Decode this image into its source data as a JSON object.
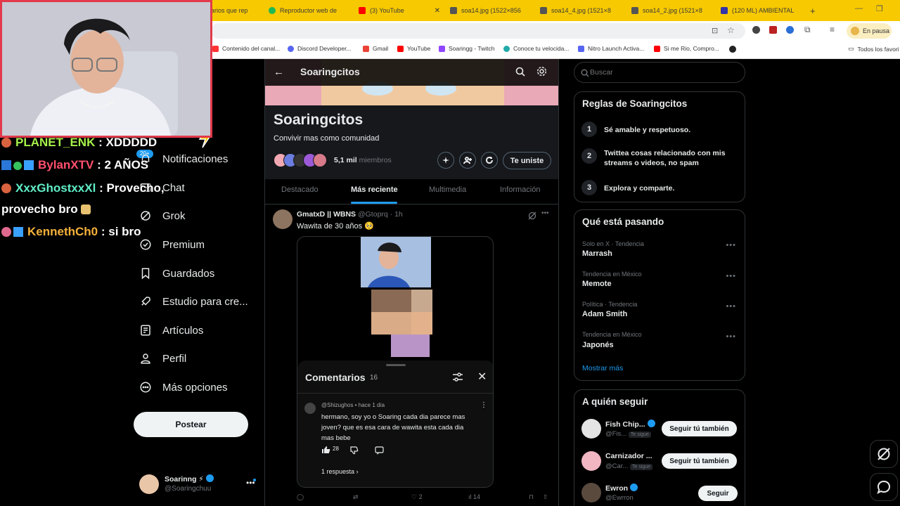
{
  "browser": {
    "tabs": [
      {
        "label": "arios que rep",
        "color": "#e66"
      },
      {
        "label": "Reproductor web de",
        "color": "#1db954"
      },
      {
        "label": "(3) YouTube",
        "color": "#f00"
      },
      {
        "label": "soa14.jpg (1522×856",
        "color": "#888"
      },
      {
        "label": "soa14_4.jpg (1521×8",
        "color": "#888"
      },
      {
        "label": "soa14_2.jpg (1521×8",
        "color": "#888"
      },
      {
        "label": "(120 ML) AMBIENTAL",
        "color": "#33a"
      }
    ],
    "new_tab": "+",
    "profile_label": "En pausa",
    "bookmarks": [
      {
        "label": "Contenido del canal...",
        "color": "#f33"
      },
      {
        "label": "Discord Developer...",
        "color": "#5865f2"
      },
      {
        "label": "Gmail",
        "color": "#ea4335"
      },
      {
        "label": "YouTube",
        "color": "#f00"
      },
      {
        "label": "Soaringg - Twitch",
        "color": "#9146ff"
      },
      {
        "label": "Conoce tu velocida...",
        "color": "#2aa"
      },
      {
        "label": "Nitro Launch Activa...",
        "color": "#5865f2"
      },
      {
        "label": "Si me Rio, Compro...",
        "color": "#f00"
      }
    ],
    "all_bookmarks": "Todos los favori"
  },
  "chat": [
    {
      "user": "PLANET_ENK",
      "msg": ": XDDDDD",
      "color": "#a6f04a"
    },
    {
      "user": "BylanXTV",
      "msg": ": 2 AÑOS",
      "color": "#ff4f6d"
    },
    {
      "user": "XxxGhostxxXl",
      "msg": ": Provecho,",
      "color": "#5ff0c8"
    },
    {
      "cont": "provecho bro"
    },
    {
      "user": "KennethCh0",
      "msg": ": si bro",
      "color": "#f7b23b"
    }
  ],
  "sidebar": {
    "badge": "20+",
    "items": [
      "Notificaciones",
      "Chat",
      "Grok",
      "Premium",
      "Guardados",
      "Estudio para cre...",
      "Artículos",
      "Perfil",
      "Más opciones"
    ],
    "post_button": "Postear",
    "account": {
      "name": "Soarinng ⚡",
      "handle": "@Soaringchuu"
    }
  },
  "community": {
    "header_title": "Soaringcitos",
    "name": "Soaringcitos",
    "description": "Convivir mas como comunidad",
    "members_count": "5,1 mil",
    "members_label": "miembros",
    "join_button": "Te uniste",
    "tabs": [
      "Destacado",
      "Más reciente",
      "Multimedia",
      "Información"
    ],
    "active_tab": 1
  },
  "post": {
    "author": "GmatxD || WBNS",
    "handle": "@Gtoprq",
    "time": "· 1h",
    "text": "Wawita de 30 años 🥺",
    "actions": {
      "likes": "2",
      "views": "14"
    }
  },
  "comments": {
    "title": "Comentarios",
    "count": "16",
    "item": {
      "author": "@Shizughos",
      "time": "• hace 1 día",
      "text": "hermano, soy yo o Soaring cada dia parece mas joven? que es esa cara de wawita esta cada dia mas bebe",
      "likes": "28",
      "replies": "1 respuesta"
    }
  },
  "search": {
    "placeholder": "Buscar"
  },
  "rules": {
    "title": "Reglas de Soaringcitos",
    "items": [
      {
        "n": "1",
        "text": "Sé amable y respetuoso."
      },
      {
        "n": "2",
        "text": "Twittea cosas relacionado con mis streams o videos, no spam"
      },
      {
        "n": "3",
        "text": "Explora y comparte."
      }
    ]
  },
  "trends": {
    "title": "Qué está pasando",
    "items": [
      {
        "meta": "Solo en X · Tendencia",
        "name": "Marrash"
      },
      {
        "meta": "Tendencia en México",
        "name": "Memote"
      },
      {
        "meta": "Política · Tendencia",
        "name": "Adam Smith"
      },
      {
        "meta": "Tendencia en México",
        "name": "Japonés"
      }
    ],
    "show_more": "Mostrar más"
  },
  "who_to_follow": {
    "title": "A quién seguir",
    "items": [
      {
        "name": "Fish Chip...",
        "handle": "@Fis...",
        "follows": "Te sigue",
        "button": "Seguir tú también"
      },
      {
        "name": "Carnizador ...",
        "handle": "@Car...",
        "follows": "Te sigue",
        "button": "Seguir tú también"
      },
      {
        "name": "Ewron",
        "handle": "@Ewrron",
        "follows": "",
        "button": "Seguir"
      }
    ]
  },
  "colors": {
    "accent": "#1d9bf0",
    "tabbar": "#f7c900"
  }
}
